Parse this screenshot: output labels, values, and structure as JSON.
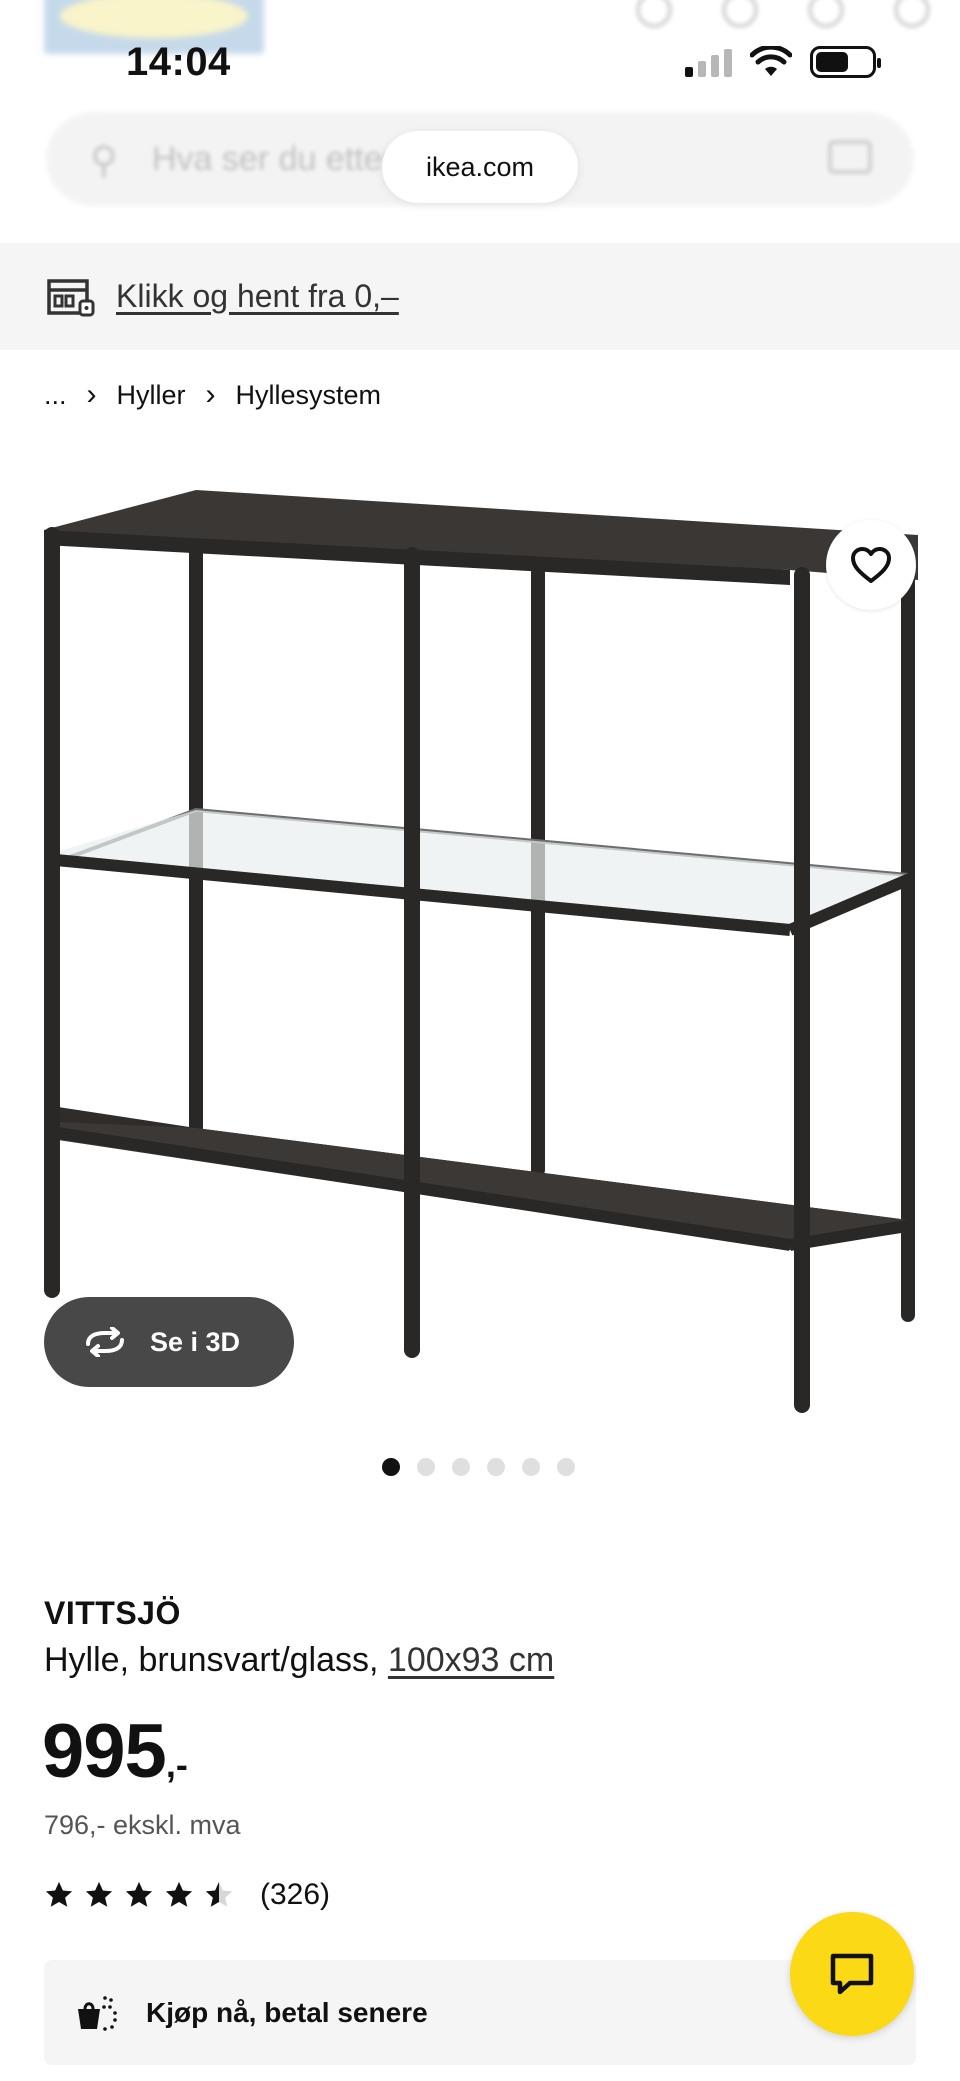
{
  "status_bar": {
    "time": "14:04"
  },
  "browser": {
    "url": "ikea.com"
  },
  "search": {
    "placeholder": "Hva ser du etter?"
  },
  "click_collect": {
    "label": "Klikk og hent fra 0,–"
  },
  "breadcrumb": {
    "ellipsis": "...",
    "items": [
      "Hyller",
      "Hyllesystem"
    ]
  },
  "gallery": {
    "view_3d_label": "Se i 3D",
    "image_count": 6,
    "active_index": 0
  },
  "product": {
    "name": "VITTSJÖ",
    "description": "Hylle, brunsvart/glass,",
    "size": "100x93 cm",
    "price_integer": "995",
    "price_suffix": ",-",
    "price_ex_vat": "796,- ekskl. mva",
    "rating": 4.5,
    "review_count": "(326)"
  },
  "bnpl": {
    "label": "Kjøp nå, betal senere"
  },
  "colors": {
    "accent_yellow": "#fbd914",
    "dark_button": "#484848",
    "shelf_frame": "#2a2826",
    "panel_grey": "#f5f5f5"
  },
  "icons": {
    "favorite": "heart-outline-icon",
    "view_3d": "rotate-icon",
    "chat": "chat-bubble-icon",
    "click_collect": "store-pickup-icon",
    "bnpl": "shopping-bag-icon"
  }
}
